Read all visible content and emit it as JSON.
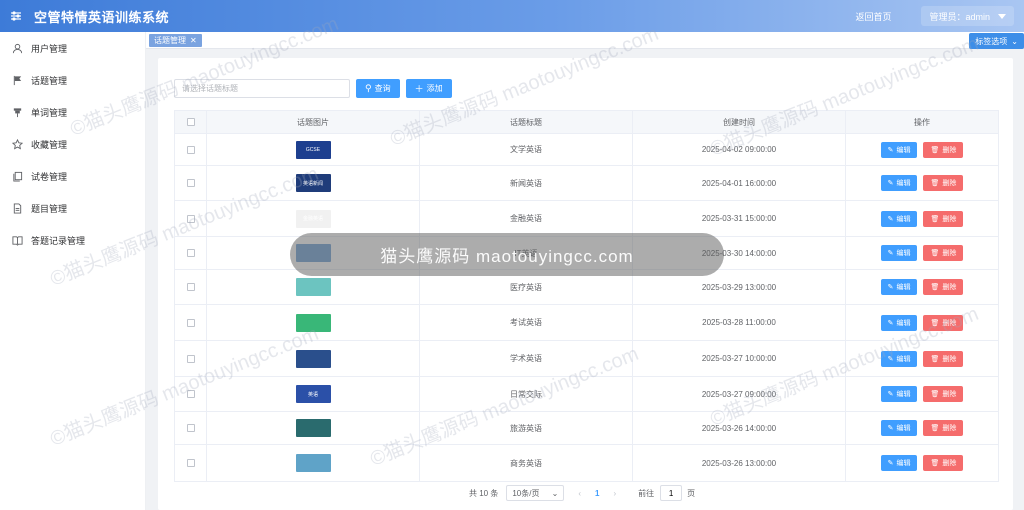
{
  "header": {
    "title": "空管特情英语训练系统",
    "home_link": "返回首页",
    "user_label": "管理员：admin"
  },
  "sidebar": {
    "items": [
      {
        "label": "用户管理",
        "icon": "user-icon"
      },
      {
        "label": "话题管理",
        "icon": "flag-icon"
      },
      {
        "label": "单词管理",
        "icon": "pin-icon"
      },
      {
        "label": "收藏管理",
        "icon": "star-icon"
      },
      {
        "label": "试卷管理",
        "icon": "copy-icon"
      },
      {
        "label": "题目管理",
        "icon": "document-icon"
      },
      {
        "label": "答题记录管理",
        "icon": "book-icon"
      }
    ]
  },
  "tags": {
    "active": "话题管理",
    "options_label": "标签选项"
  },
  "search": {
    "placeholder": "请选择话题标题",
    "query_label": "查询",
    "add_label": "添加"
  },
  "table": {
    "headers": [
      "话题图片",
      "话题标题",
      "创建时间",
      "操作"
    ],
    "edit_label": "编辑",
    "delete_label": "删除",
    "rows": [
      {
        "title": "文学英语",
        "created": "2025-04-02 09:00:00",
        "thumb_color": "#1d3f8f",
        "thumb_text": "GCSE"
      },
      {
        "title": "新闻英语",
        "created": "2025-04-01 16:00:00",
        "thumb_color": "#1f3c7a",
        "thumb_text": "英语新闻"
      },
      {
        "title": "金融英语",
        "created": "2025-03-31 15:00:00",
        "thumb_color": "#f1f1f1",
        "thumb_text": "金融英语"
      },
      {
        "title": "IT英语",
        "created": "2025-03-30 14:00:00",
        "thumb_color": "#7aa8d8",
        "thumb_text": ""
      },
      {
        "title": "医疗英语",
        "created": "2025-03-29 13:00:00",
        "thumb_color": "#6cc4c0",
        "thumb_text": ""
      },
      {
        "title": "考试英语",
        "created": "2025-03-28 11:00:00",
        "thumb_color": "#39b778",
        "thumb_text": ""
      },
      {
        "title": "学术英语",
        "created": "2025-03-27 10:00:00",
        "thumb_color": "#2a4f8c",
        "thumb_text": ""
      },
      {
        "title": "日常交际",
        "created": "2025-03-27 09:00:00",
        "thumb_color": "#2b50a8",
        "thumb_text": "英语"
      },
      {
        "title": "旅游英语",
        "created": "2025-03-26 14:00:00",
        "thumb_color": "#2a6b6e",
        "thumb_text": ""
      },
      {
        "title": "商务英语",
        "created": "2025-03-26 13:00:00",
        "thumb_color": "#5fa3c8",
        "thumb_text": ""
      }
    ]
  },
  "pagination": {
    "total": "共 10 条",
    "page_size": "10条/页",
    "current_page": "1",
    "goto_label": "前往",
    "goto_value": "1",
    "page_suffix": "页"
  },
  "watermark": {
    "overlay": "猫头鹰源码 maotouyingcc.com",
    "tile": "©猫头鹰源码 maotouyingcc.com"
  }
}
